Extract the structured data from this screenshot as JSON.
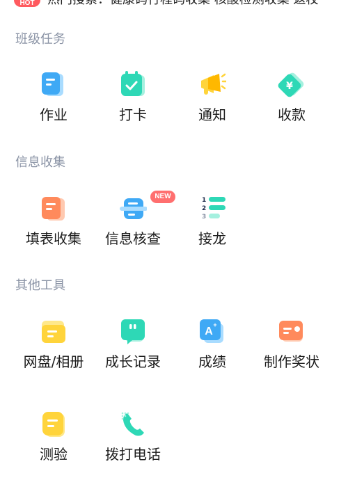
{
  "hot_bar": {
    "badge": "HOT",
    "text": "热门搜索：健康码行程码收集  核酸检测收集  返校"
  },
  "sections": [
    {
      "title": "班级任务",
      "items": [
        {
          "label": "作业",
          "icon": "homework-icon"
        },
        {
          "label": "打卡",
          "icon": "check-in-icon"
        },
        {
          "label": "通知",
          "icon": "megaphone-icon"
        },
        {
          "label": "收款",
          "icon": "payment-icon"
        }
      ]
    },
    {
      "title": "信息收集",
      "items": [
        {
          "label": "填表收集",
          "icon": "form-icon"
        },
        {
          "label": "信息核查",
          "icon": "scan-icon",
          "badge": "NEW"
        },
        {
          "label": "接龙",
          "icon": "numbered-list-icon"
        }
      ]
    },
    {
      "title": "其他工具",
      "items": [
        {
          "label": "网盘/相册",
          "icon": "folder-icon"
        },
        {
          "label": "成长记录",
          "icon": "quote-icon"
        },
        {
          "label": "成绩",
          "icon": "grade-icon"
        },
        {
          "label": "制作奖状",
          "icon": "certificate-icon"
        },
        {
          "label": "测验",
          "icon": "quiz-icon"
        },
        {
          "label": "拨打电话",
          "icon": "phone-icon"
        }
      ]
    }
  ],
  "colors": {
    "section_title": "#8a93a5",
    "blue": "#3fa9f5",
    "teal": "#2ed8b6",
    "yellow": "#ffd43b",
    "orange": "#ff8a5c",
    "badge_red": "#ff5a5f"
  }
}
